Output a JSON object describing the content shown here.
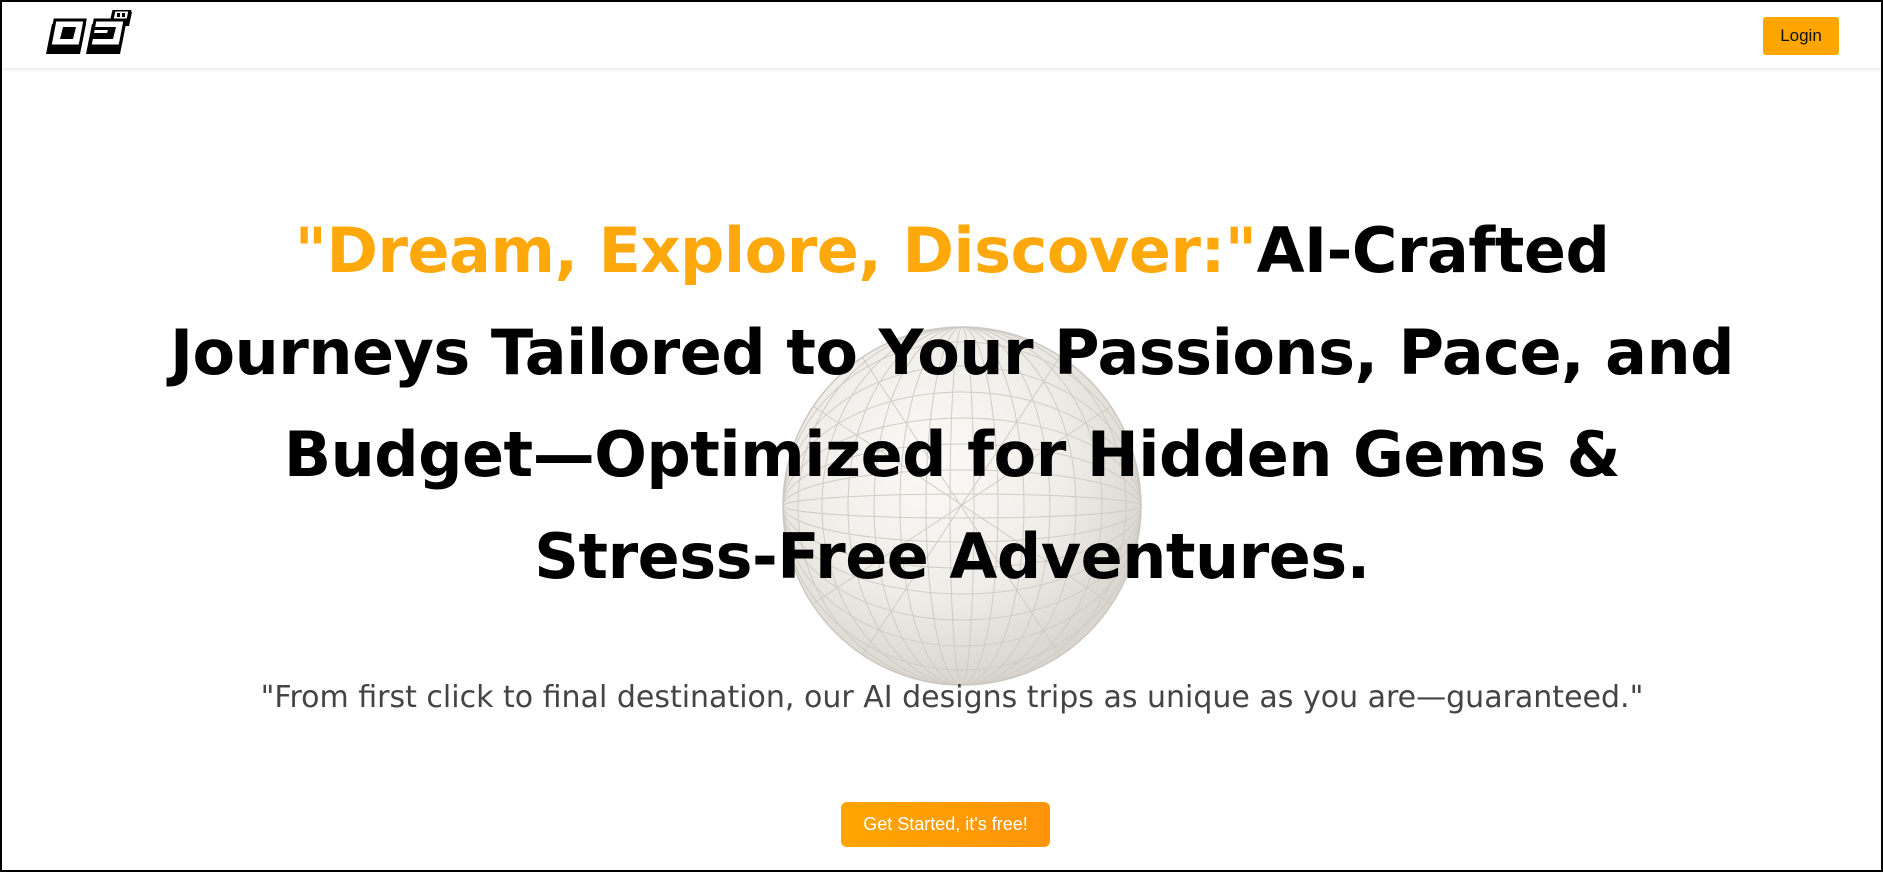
{
  "header": {
    "logo_icon": "oj-logo-icon",
    "login_label": "Login"
  },
  "hero": {
    "headline_accent": "\"Dream, Explore, Discover:\"",
    "headline_main": "AI-Crafted Journeys Tailored to Your Passions, Pace, and Budget—Optimized for Hidden Gems & Stress-Free Adventures.",
    "subheadline": "\"From first click to final destination, our AI designs trips as unique as you are—guaranteed.\"",
    "cta_label": "Get Started, it's free!",
    "background_icon": "wireframe-globe-icon"
  },
  "colors": {
    "accent": "#ffa500",
    "headline_text": "#000000",
    "subheadline_text": "#444444",
    "button_text_light": "#ffffff"
  }
}
